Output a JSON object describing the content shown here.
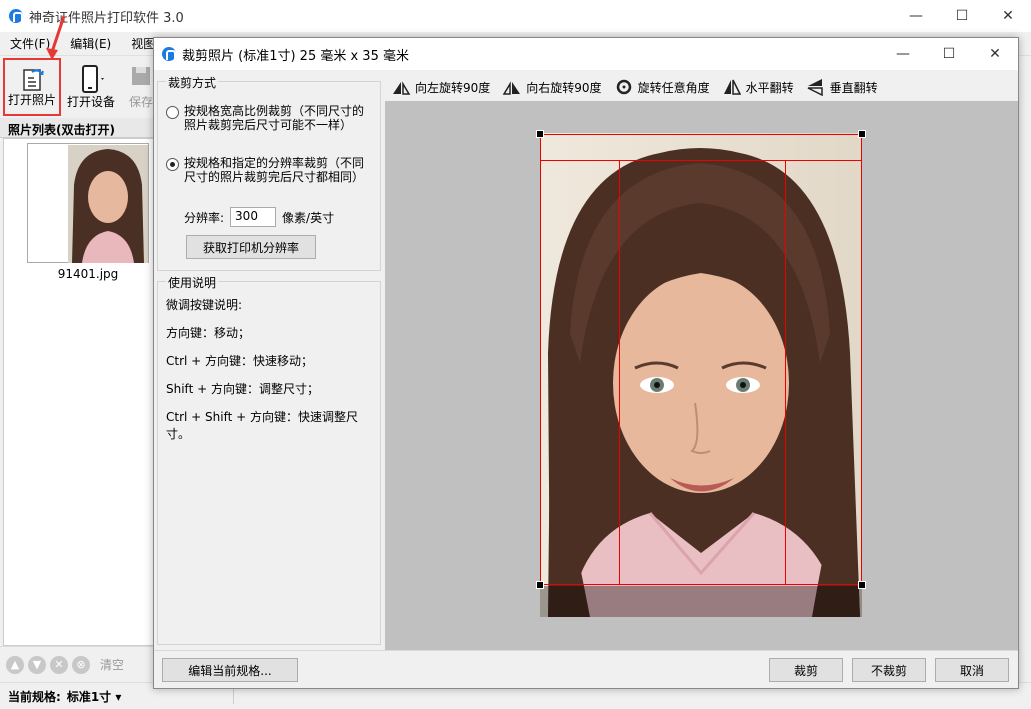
{
  "main_window": {
    "title": "神奇证件照片打印软件 3.0",
    "controls": {
      "minimize": "—",
      "maximize": "☐",
      "close": "✕"
    }
  },
  "menu": [
    "文件(F)",
    "编辑(E)",
    "视图(V)"
  ],
  "toolbar": {
    "open_photo": "打开照片",
    "open_device": "打开设备",
    "save": "保存"
  },
  "photo_list": {
    "header": "照片列表(双击打开)",
    "items": [
      {
        "filename": "91401.jpg"
      }
    ]
  },
  "bottom_tools": {
    "clear": "清空"
  },
  "status": {
    "current_spec_label": "当前规格:",
    "current_spec_value": "标准1寸"
  },
  "dialog": {
    "title": "裁剪照片 (标准1寸) 25 毫米 x 35 毫米",
    "crop_mode": {
      "group_label": "裁剪方式",
      "option1": "按规格宽高比例裁剪（不同尺寸的照片裁剪完后尺寸可能不一样）",
      "option2": "按规格和指定的分辨率裁剪（不同尺寸的照片裁剪完后尺寸都相同）",
      "selected": "option2",
      "resolution_label": "分辨率:",
      "resolution_value": "300",
      "resolution_unit": "像素/英寸",
      "get_printer_res_button": "获取打印机分辨率"
    },
    "help": {
      "group_label": "使用说明",
      "lines": [
        "微调按键说明:",
        "方向键：移动；",
        "Ctrl + 方向键：快速移动；",
        "Shift + 方向键：调整尺寸；",
        "Ctrl + Shift + 方向键：快速调整尺寸。"
      ]
    },
    "crop_toolbar": {
      "rotate_left": "向左旋转90度",
      "rotate_right": "向右旋转90度",
      "rotate_any": "旋转任意角度",
      "flip_horizontal": "水平翻转",
      "flip_vertical": "垂直翻转"
    },
    "buttons": {
      "edit_spec": "编辑当前规格...",
      "crop": "裁剪",
      "no_crop": "不裁剪",
      "cancel": "取消"
    }
  },
  "colors": {
    "accent": "#1b7be0",
    "highlight_red": "#e53935",
    "crop_red": "#e00000"
  }
}
